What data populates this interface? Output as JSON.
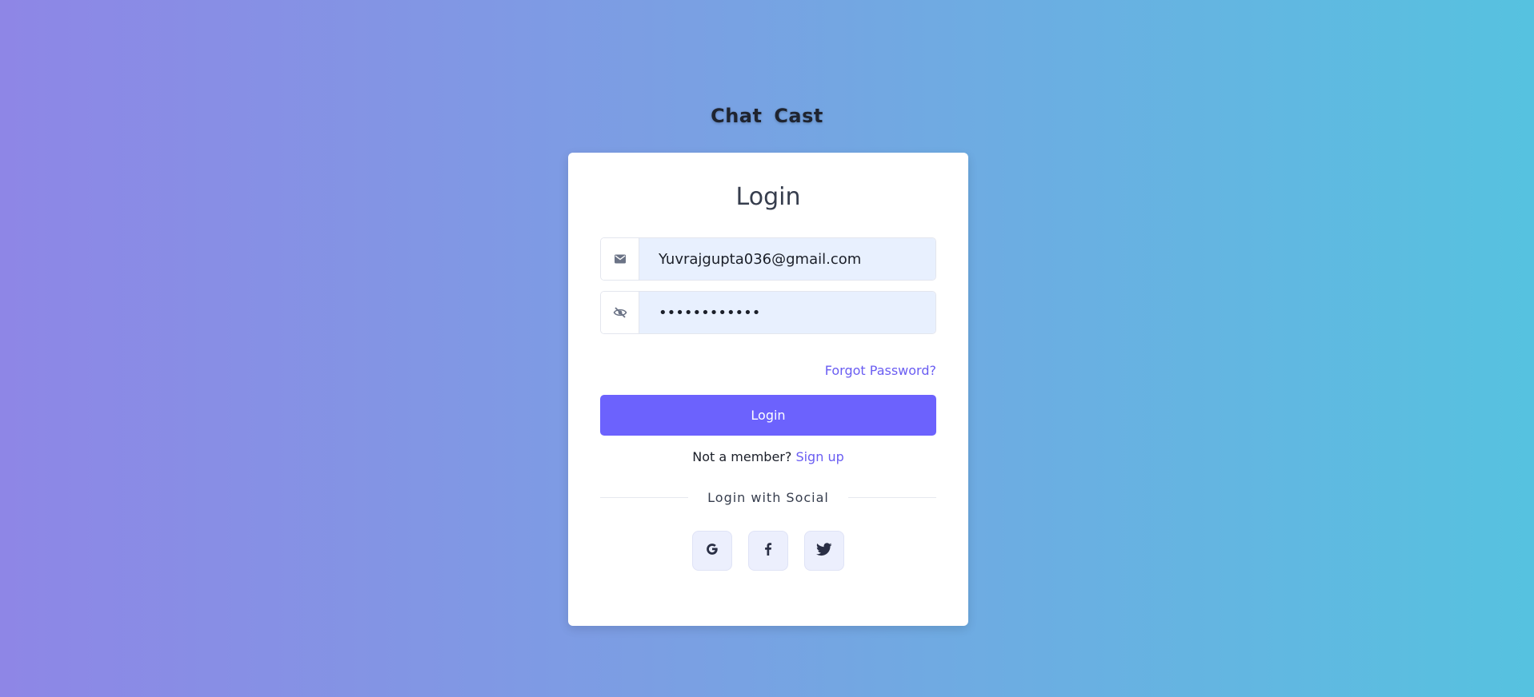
{
  "app": {
    "brand": "Chat  Cast"
  },
  "login": {
    "title": "Login",
    "email": {
      "value": "Yuvrajgupta036@gmail.com",
      "icon": "mail-icon"
    },
    "password": {
      "value": "••••••••••••",
      "icon": "eye-off-icon"
    },
    "forgot_label": "Forgot Password?",
    "submit_label": "Login",
    "member_prompt": "Not a member?",
    "signup_label": "Sign up",
    "social_label": "Login with Social",
    "socials": [
      {
        "name": "google",
        "icon": "google-icon"
      },
      {
        "name": "facebook",
        "icon": "facebook-icon"
      },
      {
        "name": "twitter",
        "icon": "twitter-icon"
      }
    ]
  },
  "colors": {
    "accent": "#6c62fd",
    "link": "#6a5df2",
    "input_bg": "#e8f0fe",
    "gradient_start": "#8e86e6",
    "gradient_end": "#56c2e0"
  }
}
